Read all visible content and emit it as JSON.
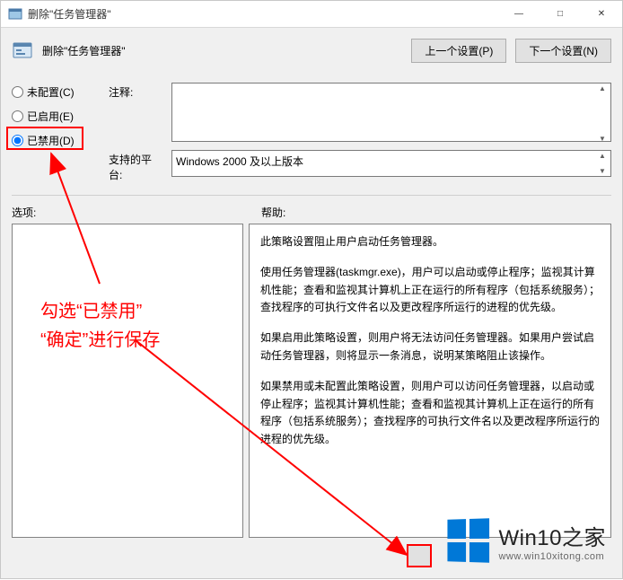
{
  "window": {
    "title": "删除\"任务管理器\"",
    "minimize_glyph": "—",
    "maximize_glyph": "□",
    "close_glyph": "✕"
  },
  "header": {
    "policy_title": "删除\"任务管理器\"",
    "prev_label": "上一个设置(P)",
    "next_label": "下一个设置(N)"
  },
  "radios": {
    "not_configured": "未配置(C)",
    "enabled": "已启用(E)",
    "disabled": "已禁用(D)"
  },
  "labels": {
    "comment": "注释:",
    "platform": "支持的平台:",
    "options": "选项:",
    "help": "帮助:"
  },
  "fields": {
    "comment_value": "",
    "platform_value": "Windows 2000 及以上版本"
  },
  "help": {
    "p1": "此策略设置阻止用户启动任务管理器。",
    "p2": "使用任务管理器(taskmgr.exe)，用户可以启动或停止程序；监视其计算机性能；查看和监视其计算机上正在运行的所有程序（包括系统服务）；查找程序的可执行文件名以及更改程序所运行的进程的优先级。",
    "p3": "如果启用此策略设置，则用户将无法访问任务管理器。如果用户尝试启动任务管理器，则将显示一条消息，说明某策略阻止该操作。",
    "p4": "如果禁用或未配置此策略设置，则用户可以访问任务管理器，以启动或停止程序；监视其计算机性能；查看和监视其计算机上正在运行的所有程序（包括系统服务）；查找程序的可执行文件名以及更改程序所运行的进程的优先级。"
  },
  "annotation": {
    "line1": "勾选“已禁用”",
    "line2": "“确定”进行保存"
  },
  "watermark": {
    "big": "Win10之家",
    "small": "www.win10xitong.com"
  }
}
